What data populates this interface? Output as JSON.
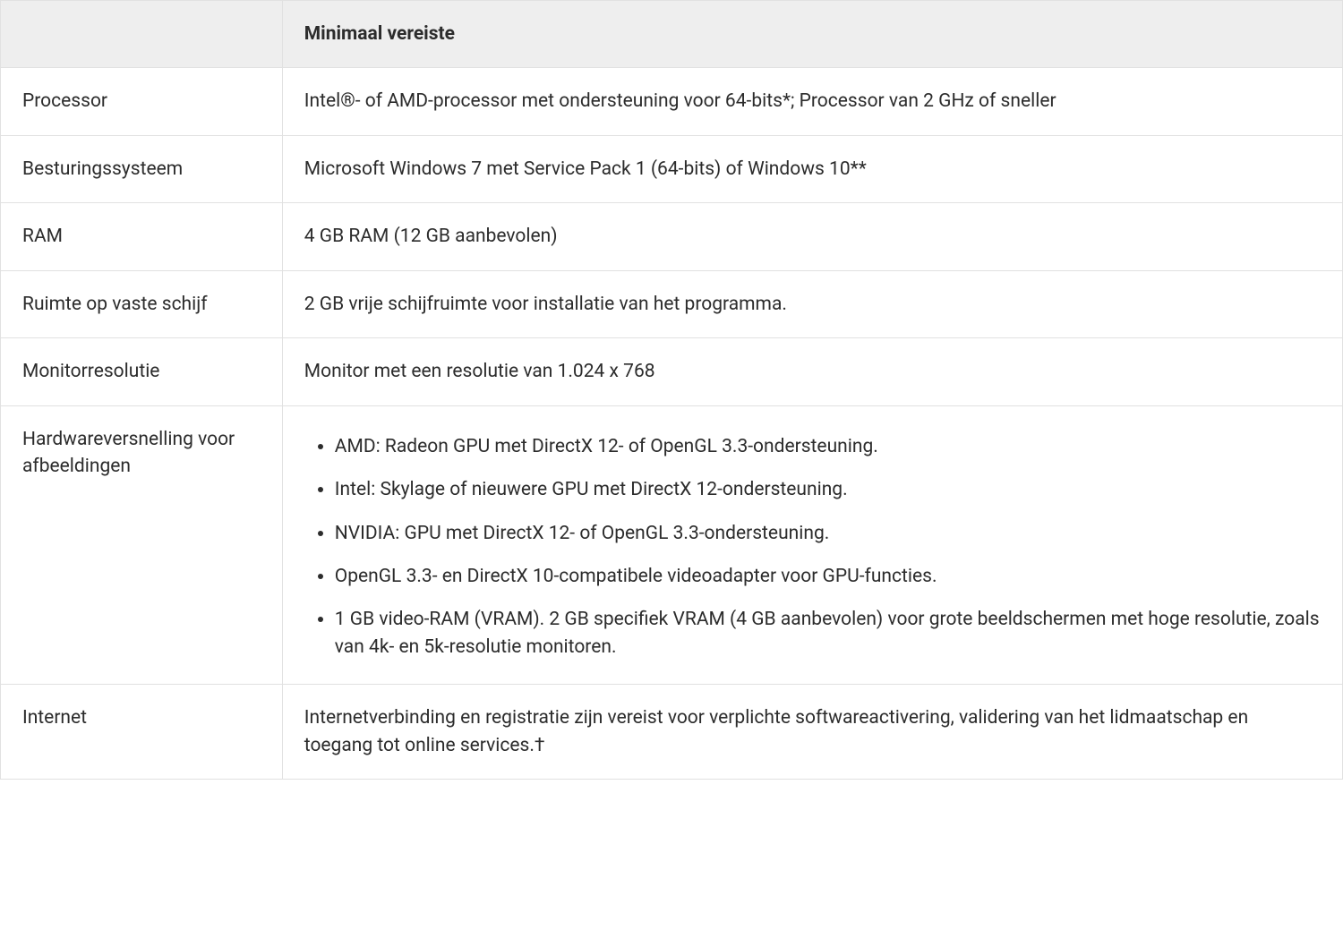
{
  "table": {
    "header": {
      "corner": "",
      "value": "Minimaal vereiste"
    },
    "rows": [
      {
        "label": "Processor",
        "value": "Intel®- of AMD-processor met ondersteuning voor 64-bits*; Processor van 2 GHz of sneller"
      },
      {
        "label": "Besturingssysteem",
        "value": "Microsoft Windows 7 met Service Pack 1 (64-bits) of Windows 10**"
      },
      {
        "label": "RAM",
        "value": "4 GB RAM (12 GB aanbevolen)"
      },
      {
        "label": "Ruimte op vaste schijf",
        "value": "2 GB vrije schijfruimte voor installatie van het programma."
      },
      {
        "label": "Monitorresolutie",
        "value": "Monitor met een resolutie van 1.024 x 768"
      },
      {
        "label": "Hardwareversnelling voor afbeeldingen",
        "items": [
          "AMD: Radeon GPU met DirectX 12- of OpenGL 3.3-ondersteuning.",
          "Intel: Skylage of nieuwere GPU met DirectX 12-ondersteuning.",
          "NVIDIA: GPU met DirectX 12- of OpenGL 3.3-ondersteuning.",
          "OpenGL 3.3- en DirectX 10-compatibele videoadapter voor GPU-functies.",
          "1 GB video-RAM (VRAM). 2 GB specifiek VRAM (4 GB aanbevolen) voor grote beeldschermen met hoge resolutie, zoals van 4k- en 5k-resolutie monitoren."
        ]
      },
      {
        "label": "Internet",
        "value": "Internetverbinding en registratie zijn vereist voor verplichte softwareactivering, validering van het lidmaatschap en toegang tot online services.†"
      }
    ]
  }
}
